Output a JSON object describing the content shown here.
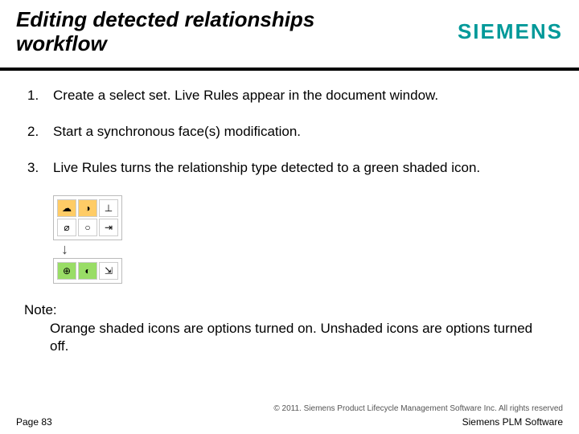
{
  "header": {
    "title": "Editing detected relationships workflow",
    "brand": "SIEMENS"
  },
  "steps": [
    "Create a select set. Live Rules appear in the document window.",
    "Start a synchronous face(s) modification.",
    "Live Rules turns the relationship type detected to a green shaded icon."
  ],
  "icon_grid": {
    "top": [
      {
        "glyph": "☁",
        "shade": "orange"
      },
      {
        "glyph": "◑",
        "shade": "orange"
      },
      {
        "glyph": "⊥",
        "shade": "none"
      }
    ],
    "mid": [
      {
        "glyph": "⌀",
        "shade": "none"
      },
      {
        "glyph": "○",
        "shade": "none"
      },
      {
        "glyph": "⇥",
        "shade": "none"
      }
    ],
    "bottom": [
      {
        "glyph": "⊕",
        "shade": "green"
      },
      {
        "glyph": "◐",
        "shade": "green"
      },
      {
        "glyph": "⇲",
        "shade": "none"
      }
    ]
  },
  "note": {
    "label": "Note:",
    "body": "Orange shaded icons are options turned on. Unshaded icons are options turned off."
  },
  "footer": {
    "copyright": "© 2011. Siemens Product Lifecycle Management Software Inc. All rights reserved",
    "page": "Page 83",
    "product": "Siemens PLM Software"
  }
}
